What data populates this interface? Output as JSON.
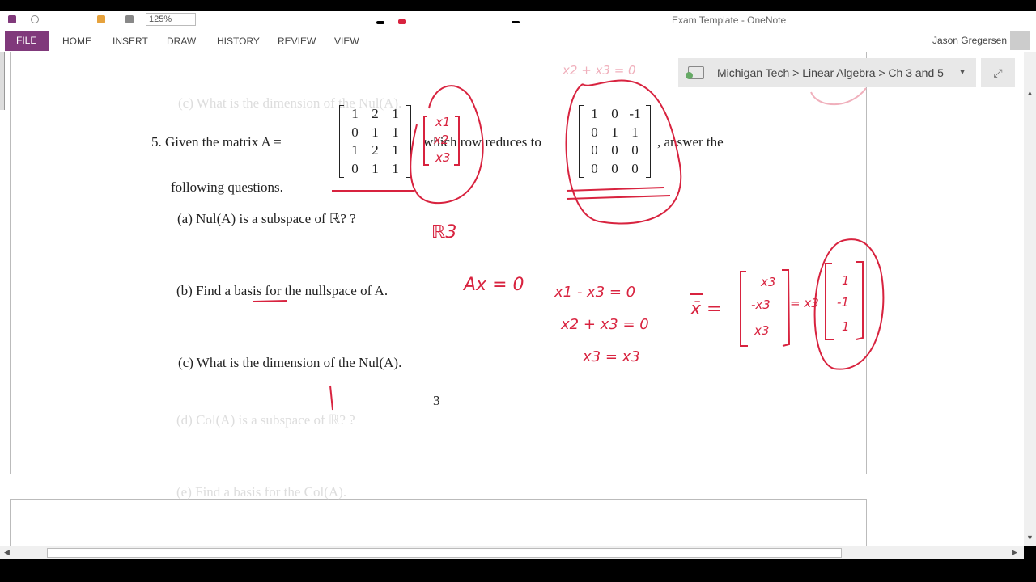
{
  "window": {
    "title": "Exam Template - OneNote",
    "zoom": "125%"
  },
  "ribbon": {
    "tabs": [
      "FILE",
      "HOME",
      "INSERT",
      "DRAW",
      "HISTORY",
      "REVIEW",
      "VIEW"
    ],
    "user": "Jason Gregersen"
  },
  "breadcrumb": {
    "path": "Michigan Tech > Linear Algebra > Ch 3 and 5"
  },
  "page": {
    "faded_top": "(c) What is the dimension of the Nul(A).",
    "q5_intro": "5.  Given the matrix  A  =",
    "q5_mid": "which row reduces to",
    "q5_end": ", answer the",
    "q5_line2": "following questions.",
    "matrix_a": [
      [
        "1",
        "2",
        "1"
      ],
      [
        "0",
        "1",
        "1"
      ],
      [
        "1",
        "2",
        "1"
      ],
      [
        "0",
        "1",
        "1"
      ]
    ],
    "matrix_r": [
      [
        "1",
        "0",
        "-1"
      ],
      [
        "0",
        "1",
        "1"
      ],
      [
        "0",
        "0",
        "0"
      ],
      [
        "0",
        "0",
        "0"
      ]
    ],
    "qa": "(a)  Nul(A) is a subspace of ℝ? ?",
    "qb": "(b)  Find a basis for the nullspace of A.",
    "qc": "(c)  What is the dimension of the Nul(A).",
    "answer_c": "3",
    "qd": "(d)  Col(A) is a subspace of ℝ? ?",
    "qe": "(e)  Find a basis for the Col(A)."
  },
  "ink": {
    "color": "#d8233f",
    "vars": [
      "x1",
      "x2",
      "x3"
    ],
    "r3": "ℝ3",
    "ax0": "Ax = 0",
    "eq1": "x1 - x3 = 0",
    "eq2": "x2 + x3 = 0",
    "eq3": "x3 = x3",
    "eq_top": "x2 + x3 = 0",
    "xbar": "x̄ =",
    "vec_general": [
      "x3",
      "-x3",
      "x3"
    ],
    "times": "= x3",
    "vec_basis": [
      "1",
      "-1",
      "1"
    ]
  }
}
